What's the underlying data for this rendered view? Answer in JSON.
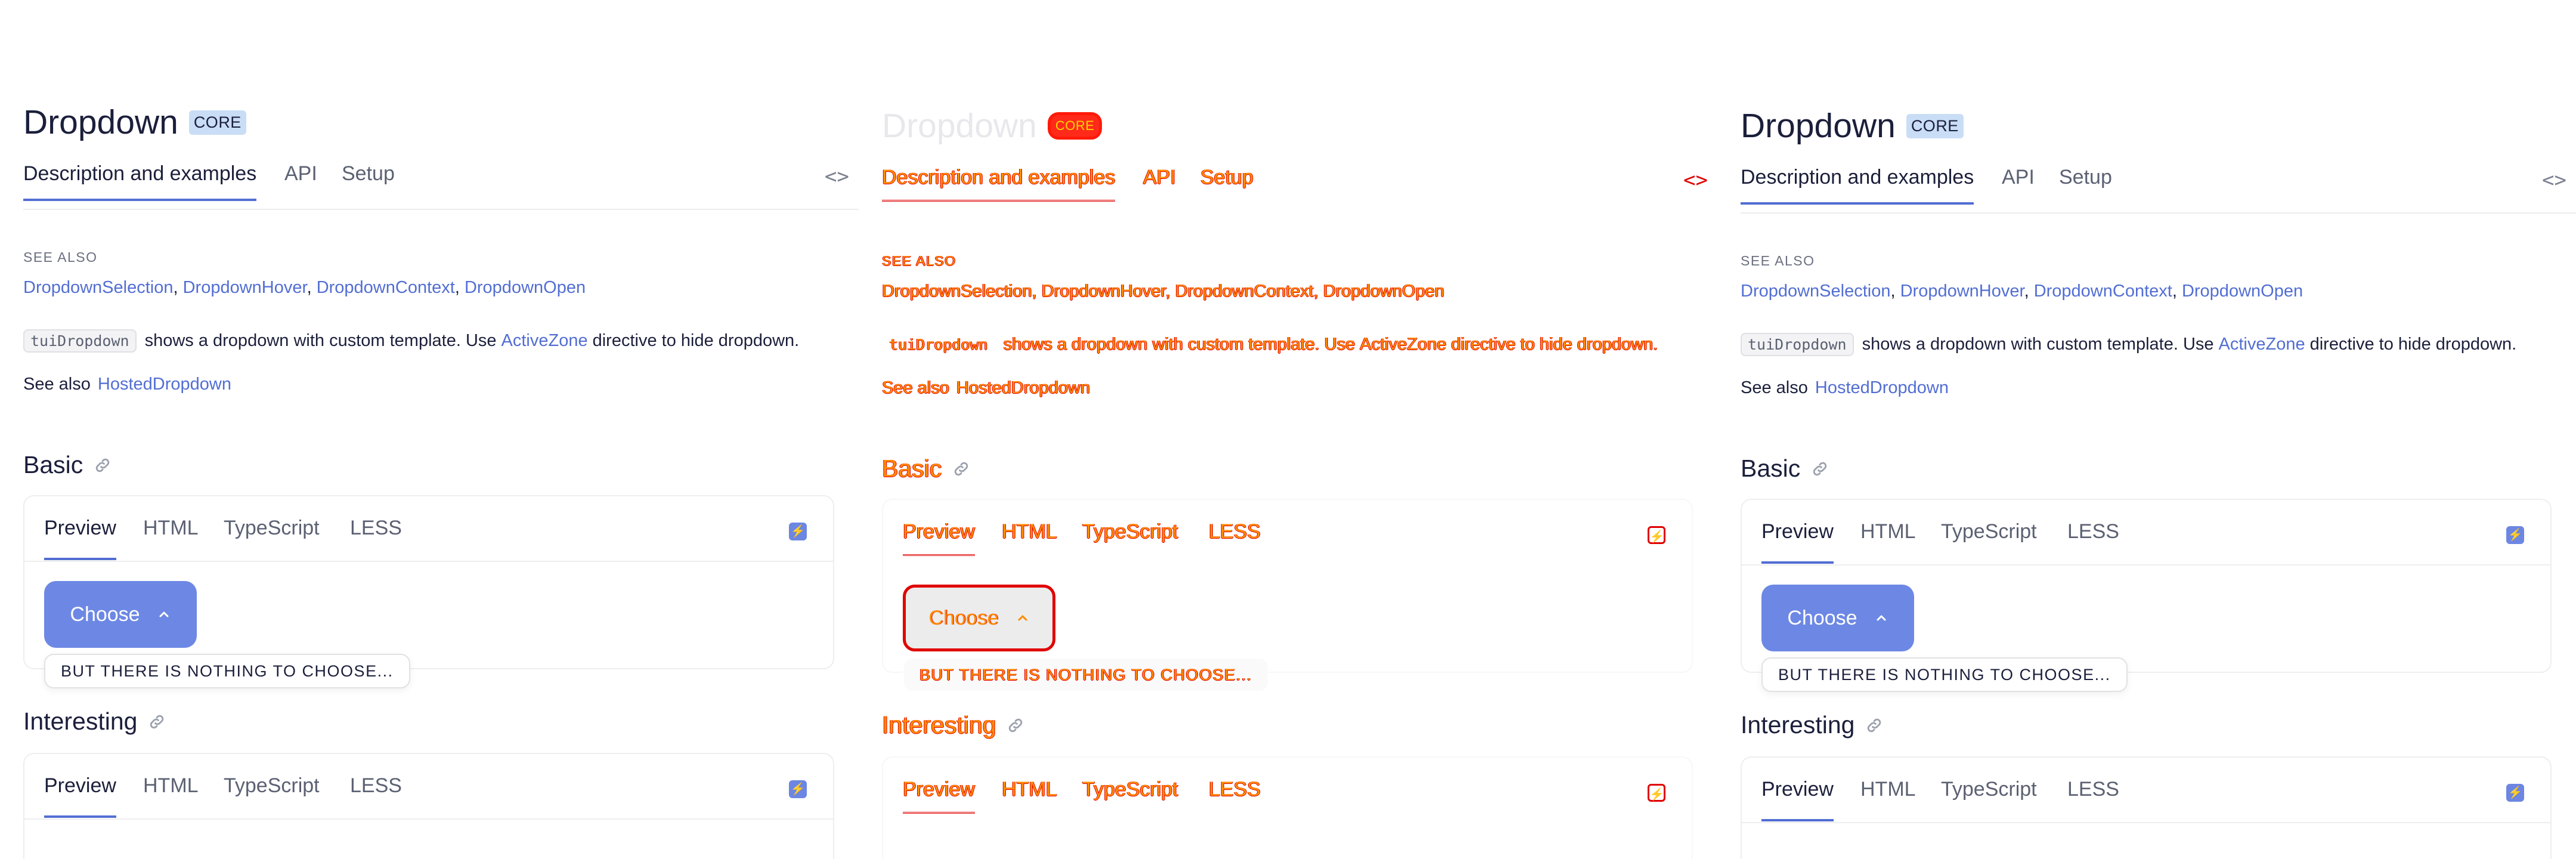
{
  "page": {
    "title": "Dropdown",
    "badge": "CORE",
    "tabs": [
      "Description and examples",
      "API",
      "Setup"
    ],
    "code_toggle": "<>",
    "see_also_heading": "SEE ALSO",
    "see_also_links": [
      "DropdownSelection",
      "DropdownHover",
      "DropdownContext",
      "DropdownOpen"
    ],
    "description": {
      "code": "tuiDropdown",
      "text_before_link": "shows a dropdown with custom template. Use",
      "link": "ActiveZone",
      "text_after_link": "directive to hide dropdown."
    },
    "see_also_line": {
      "prefix": "See also",
      "link": "HostedDropdown"
    }
  },
  "sections": {
    "basic": {
      "title": "Basic",
      "tabs": [
        "Preview",
        "HTML",
        "TypeScript",
        "LESS"
      ],
      "button_label": "Choose",
      "dropdown_text": "BUT THERE IS NOTHING TO CHOOSE..."
    },
    "interesting": {
      "title": "Interesting",
      "tabs": [
        "Preview",
        "HTML",
        "TypeScript",
        "LESS"
      ]
    }
  },
  "icons": {
    "link": "link-icon",
    "stackblitz": "stackblitz-icon",
    "chevron": "chevron-up-icon",
    "code": "code-icon"
  },
  "colors": {
    "accent": "#526ed3",
    "button": "#6d88e4",
    "badge": "#c9ddf6",
    "diff_red": "#e00000",
    "diff_orange": "#ff8c00"
  }
}
